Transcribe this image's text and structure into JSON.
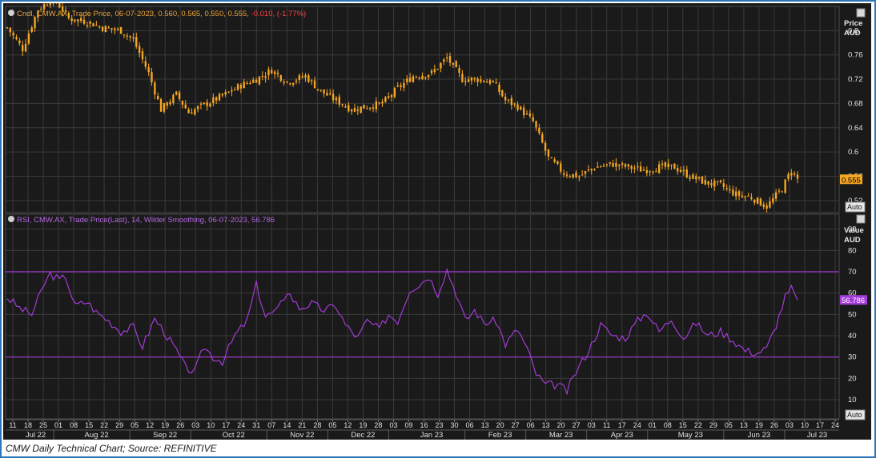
{
  "caption": "CMW Daily Technical Chart; Source: REFINITIVE",
  "colors": {
    "background": "#1a1a1a",
    "grid": "#3a3a3a",
    "candle": "#f5a623",
    "rsi": "#a33bd6",
    "reference_line": "#a33bd6",
    "axis_text": "#e0e0e0",
    "price_label_bg": "#f5a623",
    "rsi_label_bg": "#a33bd6"
  },
  "chart_data": [
    {
      "type": "candlestick",
      "legend": {
        "prefix": "Cndl, CMW.AX, Trade Price, 06-07-2023, 0.560, 0.565, 0.550, 0.555,",
        "change": "-0.010, (-1.77%)"
      },
      "axis_title": [
        "Price",
        "AUD"
      ],
      "y_ticks": [
        0.52,
        0.56,
        0.6,
        0.64,
        0.68,
        0.72,
        0.76,
        0.8
      ],
      "ylim": [
        0.5,
        0.84
      ],
      "last_value_label": "0.555",
      "last_value": 0.555,
      "auto_label": "Auto",
      "close_anchors": [
        [
          0,
          0.805
        ],
        [
          5,
          0.77
        ],
        [
          10,
          0.835
        ],
        [
          15,
          0.855
        ],
        [
          20,
          0.82
        ],
        [
          26,
          0.815
        ],
        [
          31,
          0.805
        ],
        [
          37,
          0.8
        ],
        [
          41,
          0.785
        ],
        [
          46,
          0.73
        ],
        [
          50,
          0.67
        ],
        [
          55,
          0.695
        ],
        [
          59,
          0.665
        ],
        [
          65,
          0.68
        ],
        [
          71,
          0.695
        ],
        [
          76,
          0.71
        ],
        [
          81,
          0.72
        ],
        [
          86,
          0.735
        ],
        [
          91,
          0.715
        ],
        [
          97,
          0.725
        ],
        [
          102,
          0.7
        ],
        [
          107,
          0.685
        ],
        [
          112,
          0.67
        ],
        [
          117,
          0.675
        ],
        [
          122,
          0.68
        ],
        [
          127,
          0.705
        ],
        [
          132,
          0.725
        ],
        [
          138,
          0.73
        ],
        [
          143,
          0.755
        ],
        [
          148,
          0.72
        ],
        [
          153,
          0.72
        ],
        [
          158,
          0.715
        ],
        [
          162,
          0.685
        ],
        [
          166,
          0.675
        ],
        [
          171,
          0.65
        ],
        [
          176,
          0.59
        ],
        [
          181,
          0.565
        ],
        [
          186,
          0.56
        ],
        [
          191,
          0.575
        ],
        [
          197,
          0.58
        ],
        [
          202,
          0.575
        ],
        [
          207,
          0.57
        ],
        [
          212,
          0.575
        ],
        [
          217,
          0.575
        ],
        [
          222,
          0.56
        ],
        [
          227,
          0.55
        ],
        [
          232,
          0.545
        ],
        [
          237,
          0.53
        ],
        [
          242,
          0.525
        ],
        [
          247,
          0.51
        ],
        [
          252,
          0.54
        ],
        [
          255,
          0.57
        ],
        [
          257,
          0.555
        ]
      ],
      "bars": 258
    },
    {
      "type": "line",
      "legend": "RSI, CMW.AX, Trade Price(Last),  14, Wilder Smoothing, 06-07-2023, 56.786",
      "axis_title": [
        "Value",
        "AUD"
      ],
      "y_ticks": [
        10,
        20,
        30,
        40,
        50,
        60,
        70,
        80,
        90
      ],
      "ylim": [
        1,
        97
      ],
      "reference_lines": [
        70,
        30
      ],
      "last_value_label": "56.786",
      "last_value": 56.786,
      "auto_label": "Auto",
      "rsi_anchors": [
        [
          0,
          58
        ],
        [
          4,
          53
        ],
        [
          8,
          50
        ],
        [
          12,
          64
        ],
        [
          14,
          69
        ],
        [
          17,
          66
        ],
        [
          19,
          68
        ],
        [
          22,
          54
        ],
        [
          26,
          56
        ],
        [
          29,
          51
        ],
        [
          33,
          47
        ],
        [
          37,
          42
        ],
        [
          41,
          44
        ],
        [
          44,
          35
        ],
        [
          48,
          48
        ],
        [
          51,
          42
        ],
        [
          55,
          33
        ],
        [
          58,
          25
        ],
        [
          61,
          23
        ],
        [
          64,
          35
        ],
        [
          67,
          30
        ],
        [
          70,
          28
        ],
        [
          74,
          40
        ],
        [
          78,
          47
        ],
        [
          81,
          64
        ],
        [
          84,
          49
        ],
        [
          88,
          52
        ],
        [
          91,
          61
        ],
        [
          95,
          53
        ],
        [
          99,
          55
        ],
        [
          103,
          52
        ],
        [
          107,
          54
        ],
        [
          110,
          45
        ],
        [
          114,
          39
        ],
        [
          117,
          47
        ],
        [
          121,
          43
        ],
        [
          124,
          50
        ],
        [
          127,
          47
        ],
        [
          131,
          62
        ],
        [
          134,
          64
        ],
        [
          137,
          68
        ],
        [
          140,
          60
        ],
        [
          143,
          71
        ],
        [
          146,
          60
        ],
        [
          149,
          47
        ],
        [
          152,
          52
        ],
        [
          155,
          46
        ],
        [
          159,
          47
        ],
        [
          162,
          36
        ],
        [
          166,
          43
        ],
        [
          169,
          34
        ],
        [
          172,
          22
        ],
        [
          175,
          17
        ],
        [
          179,
          17
        ],
        [
          182,
          14
        ],
        [
          185,
          23
        ],
        [
          189,
          33
        ],
        [
          193,
          45
        ],
        [
          197,
          40
        ],
        [
          201,
          39
        ],
        [
          205,
          47
        ],
        [
          208,
          51
        ],
        [
          212,
          42
        ],
        [
          216,
          48
        ],
        [
          220,
          39
        ],
        [
          224,
          46
        ],
        [
          228,
          40
        ],
        [
          232,
          42
        ],
        [
          236,
          38
        ],
        [
          240,
          33
        ],
        [
          244,
          32
        ],
        [
          247,
          34
        ],
        [
          250,
          45
        ],
        [
          253,
          58
        ],
        [
          255,
          62
        ],
        [
          257,
          56.8
        ]
      ]
    },
    {
      "type": "time_axis",
      "day_ticks": [
        "11",
        "18",
        "25",
        "01",
        "08",
        "15",
        "22",
        "29",
        "05",
        "12",
        "19",
        "26",
        "03",
        "10",
        "17",
        "24",
        "31",
        "07",
        "14",
        "21",
        "28",
        "05",
        "12",
        "19",
        "28",
        "03",
        "09",
        "16",
        "23",
        "30",
        "06",
        "13",
        "20",
        "27",
        "06",
        "13",
        "20",
        "27",
        "03",
        "11",
        "17",
        "24",
        "01",
        "08",
        "15",
        "22",
        "29",
        "05",
        "13",
        "19",
        "26",
        "03",
        "10",
        "17",
        "24"
      ],
      "months": [
        "Jul 22",
        "Aug 22",
        "Sep 22",
        "Oct 22",
        "Nov 22",
        "Dec 22",
        "Jan 23",
        "Feb 23",
        "Mar 23",
        "Apr 23",
        "May 23",
        "Jun 23",
        "Jul 23"
      ]
    }
  ]
}
